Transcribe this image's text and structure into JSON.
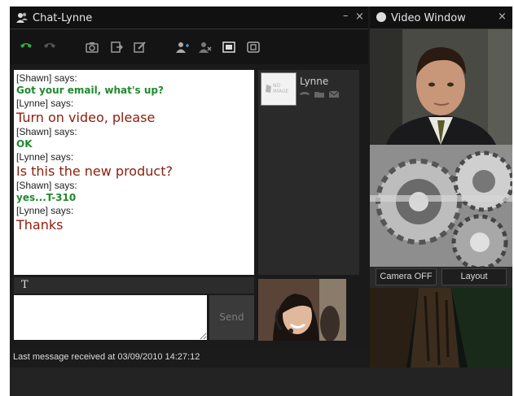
{
  "chat_window": {
    "title": "Chat-Lynne",
    "minimize": "–",
    "close": "×"
  },
  "toolbar": {
    "icons": [
      "phone-answer-icon",
      "phone-hangup-icon",
      "camera-icon",
      "send-file-icon",
      "edit-icon",
      "add-contact-icon",
      "remove-contact-icon",
      "screen-share-icon",
      "record-icon"
    ],
    "accent": "#1f8a2d"
  },
  "messages": [
    {
      "sender": "[Shawn] says:",
      "text": "Got your email, what's up?",
      "color": "#1f8a2d"
    },
    {
      "sender": "[Lynne] says:",
      "text": "Turn on video, please",
      "color": "#8b1e0c"
    },
    {
      "sender": "[Shawn] says:",
      "text": "OK",
      "color": "#1f8a2d"
    },
    {
      "sender": "[Lynne] says:",
      "text": "Is this the new product?",
      "color": "#8b1e0c"
    },
    {
      "sender": "[Shawn] says:",
      "text": "yes...T-310",
      "color": "#1f8a2d"
    },
    {
      "sender": "[Lynne] says:",
      "text": "Thanks",
      "color": "#8b1e0c"
    }
  ],
  "contact": {
    "name": "Lynne",
    "no_image_text": "NO IMAGE"
  },
  "composer": {
    "font_label": "T",
    "input_value": "",
    "send_label": "Send"
  },
  "status": {
    "text": "Last message received at 03/09/2010 14:27:12"
  },
  "video_window": {
    "title": "Video Window",
    "close": "×",
    "camera_off_label": "Camera OFF",
    "layout_label": "Layout"
  }
}
